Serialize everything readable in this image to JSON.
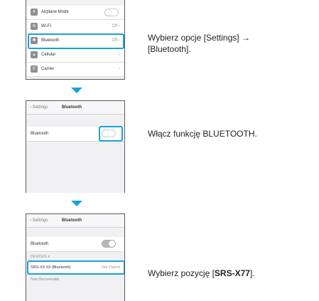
{
  "screen1": {
    "rows": [
      {
        "label": "Airplane Mode",
        "value": ""
      },
      {
        "label": "Wi-Fi",
        "value": "Off"
      },
      {
        "label": "Bluetooth",
        "value": "Off"
      },
      {
        "label": "Cellular",
        "value": ""
      },
      {
        "label": "Carrier",
        "value": ""
      }
    ]
  },
  "screen2": {
    "back": "Settings",
    "title": "Bluetooth",
    "row_label": "Bluetooth"
  },
  "screen3": {
    "back": "Settings",
    "title": "Bluetooth",
    "row_label": "Bluetooth",
    "section_header": "DEVICES",
    "device_name": "SRS-X9 X9 (Bluetooth)",
    "device_status": "Not Paired",
    "footer": "Now Discoverable"
  },
  "steps": {
    "step1_line1": "Wybierz opcje [Settings] →",
    "step1_line2": "[Bluetooth].",
    "step2": "Włącz funkcję BLUETOOTH.",
    "step3_prefix": "Wybierz pozycję [",
    "step3_bold": "SRS-X77",
    "step3_suffix": "]."
  },
  "colors": {
    "highlight": "#1aa0dc",
    "arrow": "#1aa0dc"
  }
}
